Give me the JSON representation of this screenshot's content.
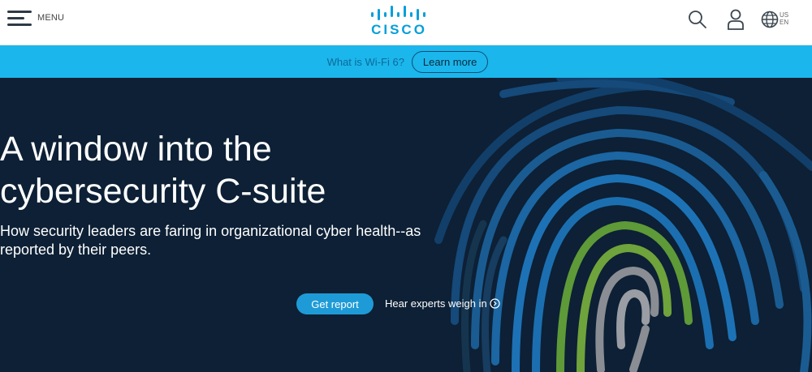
{
  "header": {
    "menu_label": "MENU",
    "logo_text": "CISCO",
    "locale_country": "US",
    "locale_language": "EN",
    "icons": [
      "search-icon",
      "user-icon",
      "globe-icon"
    ],
    "brand_color": "#049fd9"
  },
  "promo": {
    "text": "What is Wi-Fi 6?",
    "button_label": "Learn more",
    "background": "#1bb6ec"
  },
  "hero": {
    "title_line1": "A window into the",
    "title_line2": "cybersecurity C-suite",
    "subtitle_line1": "How security leaders are faring in organizational cyber health--as",
    "subtitle_line2": "reported by their peers.",
    "primary_button": "Get report",
    "secondary_link": "Hear experts weigh in",
    "background": "#0d2035",
    "accent_colors": [
      "#1b70b3",
      "#6fa33b",
      "#8a8d93"
    ]
  }
}
